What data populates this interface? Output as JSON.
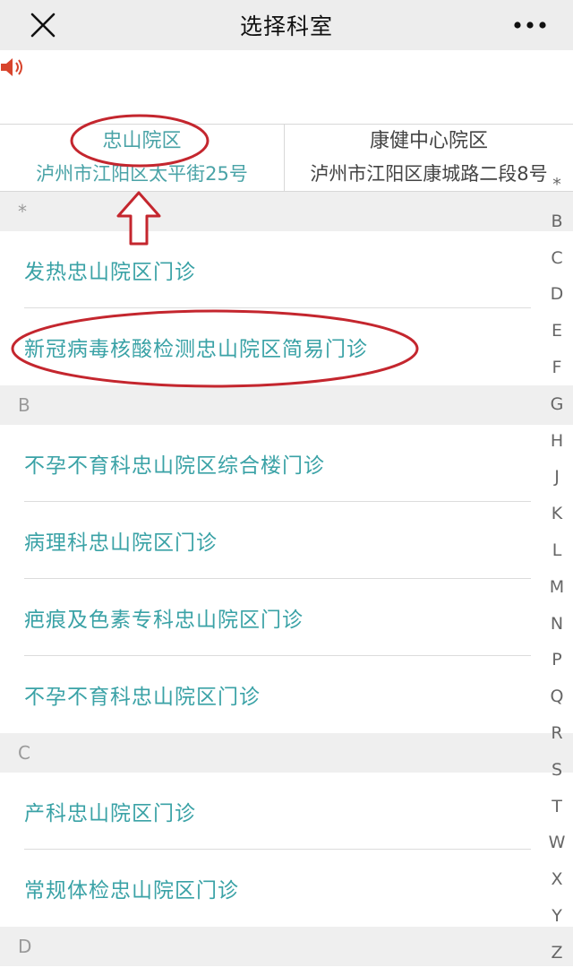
{
  "header": {
    "title": "选择科室",
    "close_icon": "close-icon",
    "more_icon": "more-icon"
  },
  "speaker_icon": "speaker-icon",
  "hospitals": [
    {
      "name": "忠山院区",
      "address": "泸州市江阳区太平街25号"
    },
    {
      "name": "康健中心院区",
      "address": "泸州市江阳区康城路二段8号"
    }
  ],
  "sections": [
    {
      "letter": "*",
      "items": [
        "发热忠山院区门诊",
        "新冠病毒核酸检测忠山院区简易门诊"
      ]
    },
    {
      "letter": "B",
      "items": [
        "不孕不育科忠山院区综合楼门诊",
        "病理科忠山院区门诊",
        "疤痕及色素专科忠山院区门诊",
        "不孕不育科忠山院区门诊"
      ]
    },
    {
      "letter": "C",
      "items": [
        "产科忠山院区门诊",
        "常规体检忠山院区门诊"
      ]
    },
    {
      "letter": "D",
      "items": []
    }
  ],
  "index_letters": [
    "*",
    "B",
    "C",
    "D",
    "E",
    "F",
    "G",
    "H",
    "J",
    "K",
    "L",
    "M",
    "N",
    "P",
    "Q",
    "R",
    "S",
    "T",
    "W",
    "X",
    "Y",
    "Z"
  ],
  "colors": {
    "accent": "#3aa2a6",
    "annotation": "#c4262e",
    "section_bg": "#efefef",
    "topbar_bg": "#ededed"
  }
}
